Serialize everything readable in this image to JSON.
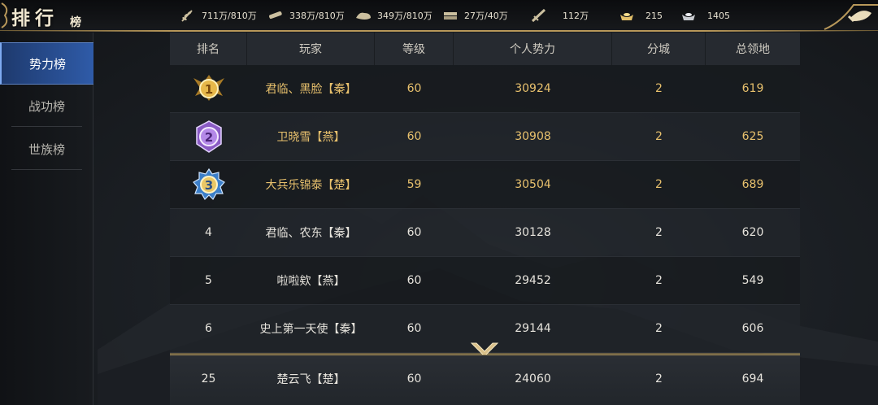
{
  "header": {
    "title_main": "排行",
    "title_sub": "榜",
    "resources": [
      {
        "icon": "grain-icon",
        "value": "711万/810万"
      },
      {
        "icon": "wood-icon",
        "value": "338万/810万"
      },
      {
        "icon": "stone-icon",
        "value": "349万/810万"
      },
      {
        "icon": "iron-icon",
        "value": "27万/40万"
      },
      {
        "icon": "sword-icon",
        "value": "112万"
      },
      {
        "icon": "gold-ingot-icon",
        "value": "215"
      },
      {
        "icon": "silver-ingot-icon",
        "value": "1405"
      }
    ]
  },
  "sidebar": {
    "items": [
      {
        "label": "势力榜",
        "active": true
      },
      {
        "label": "战功榜",
        "active": false
      },
      {
        "label": "世族榜",
        "active": false
      }
    ]
  },
  "table": {
    "headers": [
      "排名",
      "玩家",
      "等级",
      "个人势力",
      "分城",
      "总领地"
    ],
    "rows": [
      {
        "rank": "1",
        "player": "君临、黑脸【秦】",
        "level": "60",
        "power": "30924",
        "branch": "2",
        "territory": "619",
        "medal": "gold"
      },
      {
        "rank": "2",
        "player": "卫晓雪【燕】",
        "level": "60",
        "power": "30908",
        "branch": "2",
        "territory": "625",
        "medal": "purple"
      },
      {
        "rank": "3",
        "player": "大兵乐锦泰【楚】",
        "level": "59",
        "power": "30504",
        "branch": "2",
        "territory": "689",
        "medal": "blue"
      },
      {
        "rank": "4",
        "player": "君临、农东【秦】",
        "level": "60",
        "power": "30128",
        "branch": "2",
        "territory": "620"
      },
      {
        "rank": "5",
        "player": "啦啦欸【燕】",
        "level": "60",
        "power": "29452",
        "branch": "2",
        "territory": "549"
      },
      {
        "rank": "6",
        "player": "史上第一天使【秦】",
        "level": "60",
        "power": "29144",
        "branch": "2",
        "territory": "606"
      }
    ],
    "self_row": {
      "rank": "25",
      "player": "楚云飞【楚】",
      "level": "60",
      "power": "24060",
      "branch": "2",
      "territory": "694"
    }
  },
  "colors": {
    "accent_gold": "#e8c16d",
    "active_tab": "#2f5ba8"
  }
}
